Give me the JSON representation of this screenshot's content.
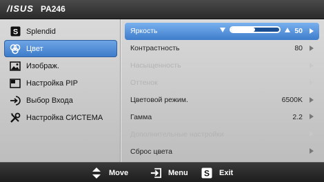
{
  "header": {
    "logo": "/ISUS",
    "model": "PA246"
  },
  "left_menu": [
    {
      "label": "Splendid",
      "icon": "splendid-s-icon",
      "selected": false
    },
    {
      "label": "Цвет",
      "icon": "color-palette-icon",
      "selected": true
    },
    {
      "label": "Изображ.",
      "icon": "picture-icon",
      "selected": false
    },
    {
      "label": "Настройка PIP",
      "icon": "pip-window-icon",
      "selected": false
    },
    {
      "label": "Выбор Входа",
      "icon": "input-arrow-icon",
      "selected": false
    },
    {
      "label": "Настройка СИСТЕМА",
      "icon": "tools-icon",
      "selected": false
    }
  ],
  "right_list": [
    {
      "label": "Яркость",
      "value": "50",
      "state": "selected",
      "slider_level": 0.5
    },
    {
      "label": "Контрастность",
      "value": "80",
      "state": "enabled"
    },
    {
      "label": "Насыщенность",
      "value": "",
      "state": "disabled"
    },
    {
      "label": "Оттенок",
      "value": "",
      "state": "disabled"
    },
    {
      "label": "Цветовой режим.",
      "value": "6500K",
      "state": "enabled"
    },
    {
      "label": "Гамма",
      "value": "2.2",
      "state": "enabled"
    },
    {
      "label": "Дополнительные настройки",
      "value": "",
      "state": "disabled"
    },
    {
      "label": "Сброс цвета",
      "value": "",
      "state": "enabled"
    }
  ],
  "footer": {
    "move_label": "Move",
    "menu_label": "Menu",
    "exit_label": "Exit"
  },
  "colors": {
    "accent": "#3e7dcb",
    "panel": "#d0d0d0",
    "disabled_text": "#b3b3b3"
  }
}
